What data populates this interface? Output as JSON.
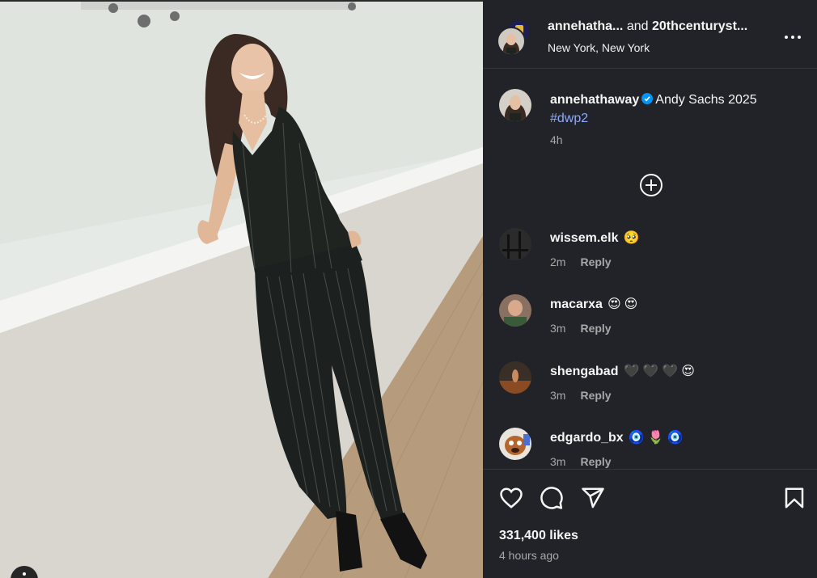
{
  "header": {
    "user1": "annehatha...",
    "conjunction": "and",
    "user2": "20thcenturyst...",
    "location": "New York, New York",
    "more_icon": "more-horizontal-icon"
  },
  "caption": {
    "username": "annehathaway",
    "text": "Andy Sachs 2025",
    "hashtag": "#dwp2",
    "time": "4h",
    "verified_color": "#0095f6"
  },
  "load_more_icon": "plus-circle-icon",
  "comments": [
    {
      "username": "wissem.elk",
      "emoji": "🥺",
      "time": "2m",
      "reply": "Reply"
    },
    {
      "username": "macarxa",
      "emoji": "😍😍",
      "time": "3m",
      "reply": "Reply"
    },
    {
      "username": "shengabad",
      "emoji": "🖤🖤🖤😍",
      "time": "3m",
      "reply": "Reply"
    },
    {
      "username": "edgardo_bx",
      "emoji": "🧿🌷🧿",
      "time": "3m",
      "reply": "Reply"
    }
  ],
  "actions": {
    "like_icon": "heart-icon",
    "comment_icon": "comment-icon",
    "share_icon": "share-icon",
    "save_icon": "bookmark-icon"
  },
  "likes": "331,400 likes",
  "posted": "4 hours ago",
  "colors": {
    "panel_bg": "#212328",
    "muted": "#a8a8a8",
    "hashtag": "#8ea9ff"
  }
}
